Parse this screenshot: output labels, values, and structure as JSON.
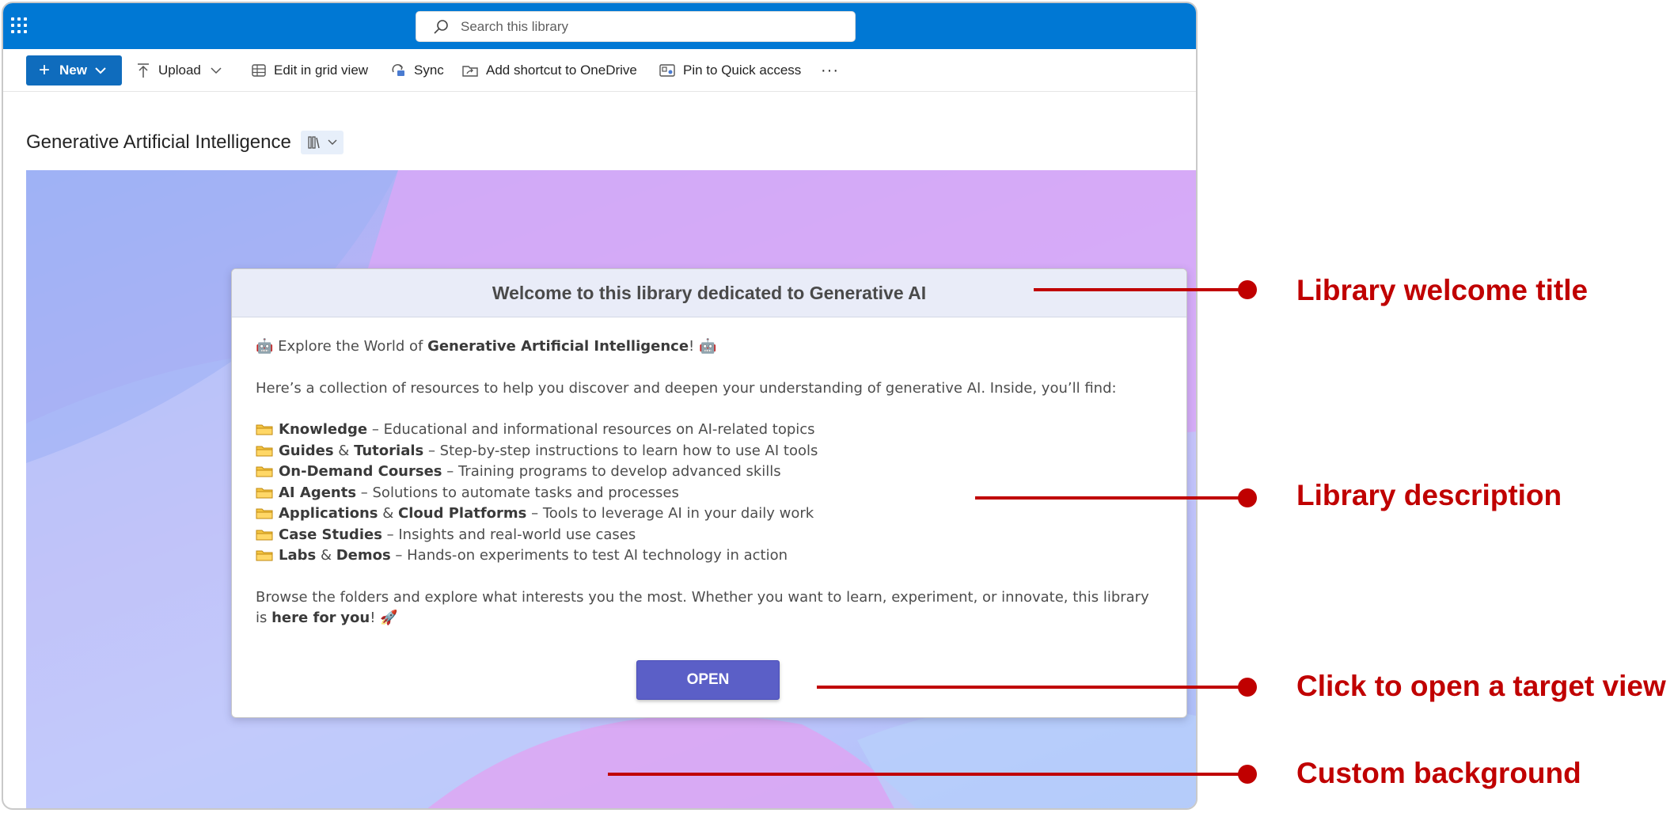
{
  "search": {
    "placeholder": "Search this library"
  },
  "toolbar": {
    "new_label": "New",
    "upload_label": "Upload",
    "grid_label": "Edit in grid view",
    "sync_label": "Sync",
    "shortcut_label": "Add shortcut to OneDrive",
    "pin_label": "Pin to Quick access",
    "more_label": "···"
  },
  "library": {
    "title": "Generative Artificial Intelligence"
  },
  "card": {
    "title": "Welcome to this library dedicated to Generative AI",
    "intro_prefix": "Explore the World of ",
    "intro_bold": "Generative Artificial Intelligence",
    "intro_suffix": "!",
    "collection": "Here’s a collection of resources to help you discover and deepen your understanding of generative AI. Inside, you’ll find:",
    "items": [
      {
        "bold1": "Knowledge",
        "amp": "",
        "bold2": "",
        "rest": " – Educational and informational resources on AI-related topics"
      },
      {
        "bold1": "Guides",
        "amp": " & ",
        "bold2": "Tutorials",
        "rest": " – Step-by-step instructions to learn how to use AI tools"
      },
      {
        "bold1": "On-Demand Courses",
        "amp": "",
        "bold2": "",
        "rest": " – Training programs to develop advanced skills"
      },
      {
        "bold1": "AI Agents",
        "amp": "",
        "bold2": "",
        "rest": " – Solutions to automate tasks and processes"
      },
      {
        "bold1": "Applications",
        "amp": " & ",
        "bold2": "Cloud Platforms",
        "rest": " – Tools to leverage AI in your daily work"
      },
      {
        "bold1": "Case Studies",
        "amp": "",
        "bold2": "",
        "rest": " – Insights and real-world use cases"
      },
      {
        "bold1": "Labs",
        "amp": " & ",
        "bold2": "Demos",
        "rest": " – Hands-on experiments to test AI technology in action"
      }
    ],
    "browse_prefix": "Browse the folders and explore what interests you the most. Whether you want to learn, experiment, or innovate, this library is ",
    "browse_bold1": "here for",
    "browse_bold2": "you",
    "browse_suffix": "!",
    "open_label": "OPEN"
  },
  "annotations": {
    "title_label": "Library welcome title",
    "description_label": "Library description",
    "open_label": "Click to open a target view",
    "background_label": "Custom background"
  },
  "colors": {
    "suitebar": "#0078d4",
    "primary_button": "#0f6cbd",
    "open_button": "#5b5fc7",
    "annotation": "#c00000"
  }
}
